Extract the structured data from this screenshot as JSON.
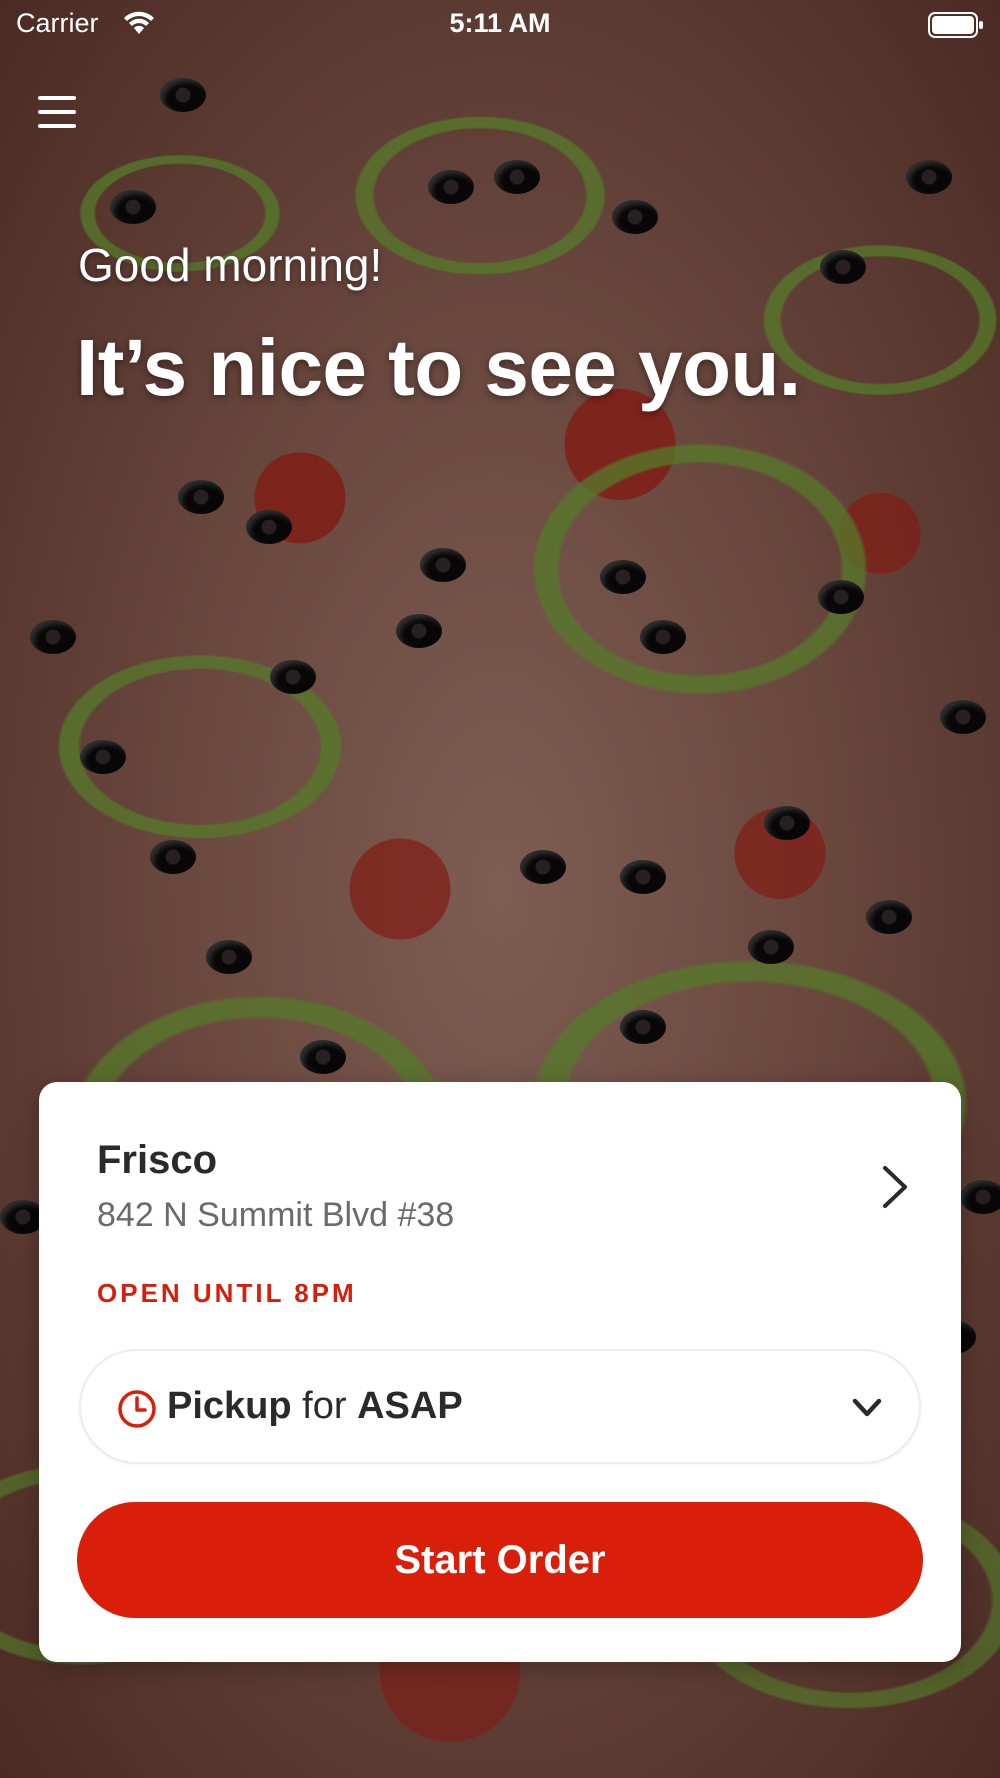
{
  "status_bar": {
    "carrier": "Carrier",
    "time": "5:11 AM",
    "wifi_icon": "wifi-icon",
    "battery_icon": "battery-icon"
  },
  "header": {
    "menu_icon": "hamburger-menu-icon"
  },
  "hero": {
    "greeting": "Good morning!",
    "headline": "It’s nice to see you."
  },
  "location": {
    "name": "Frisco",
    "address": "842 N Summit Blvd #38",
    "hours": "OPEN UNTIL 8PM"
  },
  "order_type": {
    "mode": "Pickup",
    "connector": "for",
    "time": "ASAP"
  },
  "actions": {
    "start_order_label": "Start Order"
  },
  "colors": {
    "accent": "#d91f0a",
    "card_bg": "#ffffff",
    "text_dark": "#2a2a2a",
    "text_muted": "#6a6a6a"
  }
}
